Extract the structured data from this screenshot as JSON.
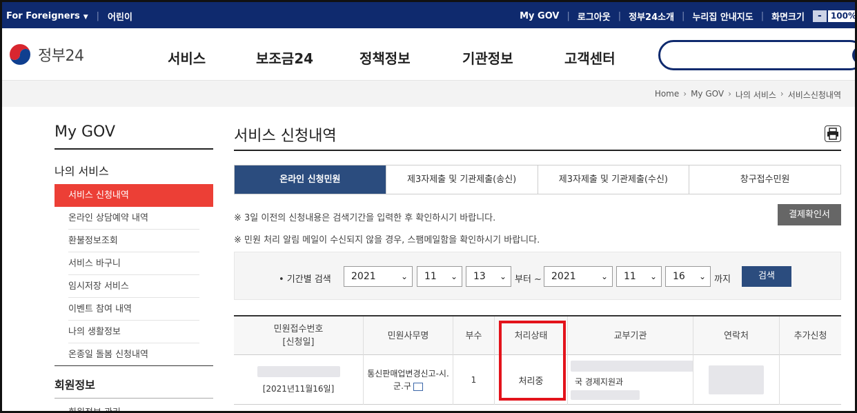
{
  "topbar": {
    "foreigners": "For Foreigners",
    "kids": "어린이",
    "mygov": "My GOV",
    "logout": "로그아웃",
    "about": "정부24소개",
    "sitemap": "누리집 안내지도",
    "screen_size": "화면크기",
    "zoom_minus": "-",
    "zoom_value": "100%"
  },
  "header": {
    "logo_text": "정부24",
    "nav": [
      "서비스",
      "보조금24",
      "정책정보",
      "기관정보",
      "고객센터"
    ],
    "search_placeholder": ""
  },
  "breadcrumb": [
    "Home",
    "My GOV",
    "나의 서비스",
    "서비스신청내역"
  ],
  "sidebar": {
    "title": "My GOV",
    "section": "나의 서비스",
    "items": [
      {
        "label": "서비스 신청내역",
        "active": true
      },
      {
        "label": "온라인 상담예약 내역"
      },
      {
        "label": "환불정보조회"
      },
      {
        "label": "서비스 바구니"
      },
      {
        "label": "임시저장 서비스"
      },
      {
        "label": "이벤트 참여 내역"
      },
      {
        "label": "나의 생활정보"
      },
      {
        "label": "온종일 돌봄 신청내역"
      }
    ],
    "section2": "회원정보",
    "section2_item": "회원정보 관리"
  },
  "main": {
    "title": "서비스 신청내역",
    "tabs": [
      "온라인 신청민원",
      "제3자제출 및 기관제출(송신)",
      "제3자제출 및 기관제출(수신)",
      "창구접수민원"
    ],
    "note1": "※ 3일 이전의 신청내용은 검색기간을 입력한 후 확인하시기 바랍니다.",
    "note2": "※ 민원 처리 알림 메일이 수신되지 않을 경우, 스팸메일함을 확인하시기 바랍니다.",
    "receipt_button": "결제확인서",
    "search": {
      "label": "• 기간별 검색",
      "from_year": "2021",
      "from_month": "11",
      "from_day": "13",
      "from_text": "부터 ~",
      "to_year": "2021",
      "to_month": "11",
      "to_day": "16",
      "to_text": "까지",
      "button": "검색"
    },
    "table": {
      "headers": [
        "민원접수번호",
        "[신청일]",
        "민원사무명",
        "부수",
        "처리상태",
        "교부기관",
        "연락처",
        "추가신청"
      ],
      "row": {
        "date": "[2021년11월16일]",
        "service_line1": "통신판매업변경신고-시.",
        "service_line2": "군.구",
        "count": "1",
        "status": "처리중",
        "agency": "국 경제지원과"
      }
    }
  },
  "colors": {
    "navy": "#0f2a6e",
    "tab_active": "#2b4c7e",
    "side_active": "#ec3f36",
    "highlight": "#e3131b"
  }
}
